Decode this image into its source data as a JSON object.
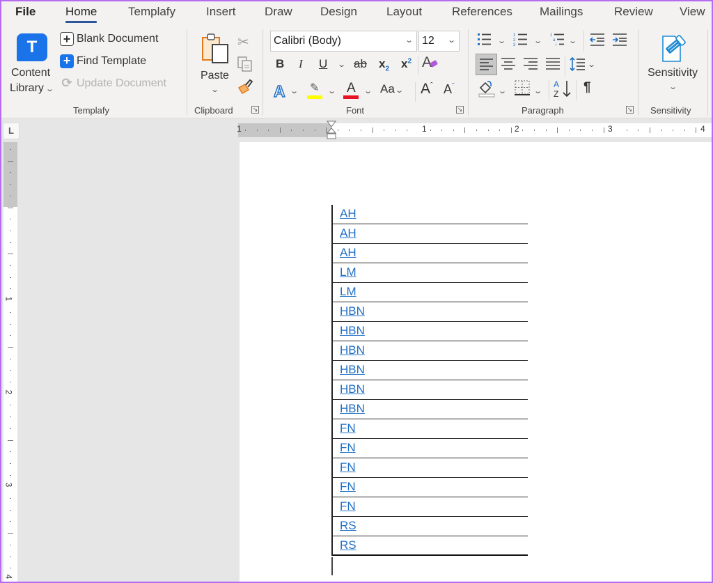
{
  "tabs": [
    {
      "label": "File",
      "active": false
    },
    {
      "label": "Home",
      "active": true
    },
    {
      "label": "Templafy",
      "active": false
    },
    {
      "label": "Insert",
      "active": false
    },
    {
      "label": "Draw",
      "active": false
    },
    {
      "label": "Design",
      "active": false
    },
    {
      "label": "Layout",
      "active": false
    },
    {
      "label": "References",
      "active": false
    },
    {
      "label": "Mailings",
      "active": false
    },
    {
      "label": "Review",
      "active": false
    },
    {
      "label": "View",
      "active": false
    }
  ],
  "ribbon": {
    "templafy": {
      "group_label": "Templafy",
      "content_library_line1": "Content",
      "content_library_line2": "Library",
      "blank_document": "Blank Document",
      "find_template": "Find Template",
      "update_document": "Update Document",
      "logo_letter": "T"
    },
    "clipboard": {
      "group_label": "Clipboard",
      "paste": "Paste"
    },
    "font": {
      "group_label": "Font",
      "font_name": "Calibri (Body)",
      "font_size": "12",
      "bold": "B",
      "italic": "I",
      "underline": "U",
      "strikethrough": "ab",
      "subscript": "x",
      "superscript": "x",
      "change_case": "Aa",
      "grow": "A",
      "shrink": "A",
      "highlight_color": "#ffff00",
      "font_color": "#e81123"
    },
    "paragraph": {
      "group_label": "Paragraph",
      "show_marks": "¶"
    },
    "sensitivity": {
      "group_label": "Sensitivity",
      "button_label": "Sensitivity"
    }
  },
  "ruler": {
    "horizontal": [
      "1",
      "1",
      "2",
      "3",
      "4"
    ],
    "vertical": [
      "1",
      "2",
      "3",
      "4"
    ],
    "tab_selector": "L"
  },
  "document": {
    "rows": [
      "AH",
      "AH",
      "AH",
      "LM",
      "LM",
      "HBN",
      "HBN",
      "HBN",
      "HBN",
      "HBN",
      "HBN",
      "FN",
      "FN",
      "FN",
      "FN",
      "FN",
      "RS",
      "RS"
    ]
  },
  "colors": {
    "accent": "#2b579a",
    "link": "#1f6fc5",
    "templafy_blue": "#1a73e8",
    "window_border": "#b56cf0"
  }
}
